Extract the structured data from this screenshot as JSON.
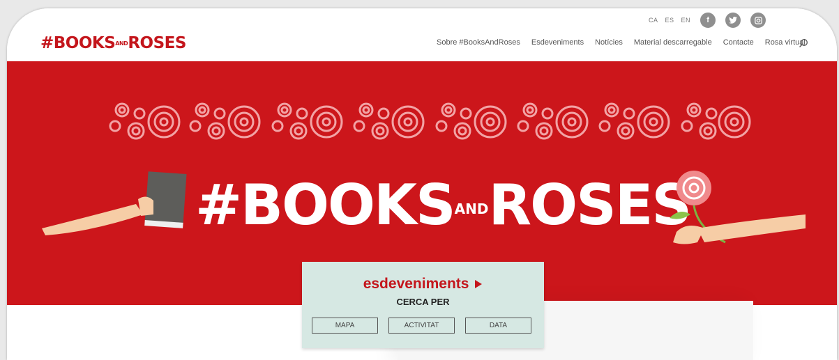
{
  "header": {
    "languages": [
      "CA",
      "ES",
      "EN"
    ],
    "social_icons": [
      "facebook-icon",
      "twitter-icon",
      "instagram-icon"
    ],
    "logo_text": "#BOOKS",
    "logo_and": "AND",
    "logo_text2": "ROSES",
    "nav": [
      "Sobre #BooksAndRoses",
      "Esdeveniments",
      "Notícies",
      "Material descarregable",
      "Contacte",
      "Rosa virtual"
    ]
  },
  "hero": {
    "title_part1": "#BOOKS",
    "title_and": "AND",
    "title_part2": "ROSES"
  },
  "panel": {
    "title": "esdeveniments",
    "subtitle": "CERCA PER",
    "buttons": [
      "MAPA",
      "ACTIVITAT",
      "DATA"
    ]
  },
  "colors": {
    "brand_red": "#cc161b",
    "panel_bg": "#d6e8e3"
  }
}
